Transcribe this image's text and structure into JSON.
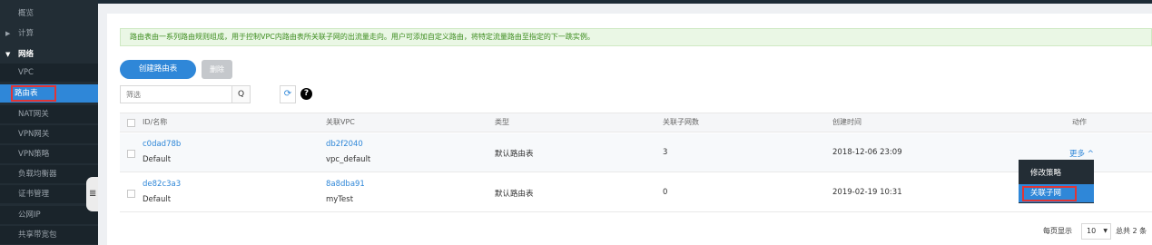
{
  "sidebar": {
    "items": [
      {
        "label": "概览"
      },
      {
        "label": "计算"
      },
      {
        "label": "网络"
      },
      {
        "label": "VPC"
      },
      {
        "label": "路由表"
      },
      {
        "label": "NAT网关"
      },
      {
        "label": "VPN网关"
      },
      {
        "label": "VPN策略"
      },
      {
        "label": "负载均衡器"
      },
      {
        "label": "证书管理"
      },
      {
        "label": "公网IP"
      },
      {
        "label": "共享带宽包"
      }
    ],
    "collapse_icon": "≣"
  },
  "notice": "路由表由一系列路由规则组成，用于控制VPC内路由表所关联子网的出流量走向。用户可添加自定义路由，将特定流量路由至指定的下一跳实例。",
  "toolbar": {
    "create_label": "创建路由表",
    "delete_label": "删除",
    "filter_placeholder": "筛选",
    "search_icon": "Q",
    "refresh_icon": "⟳",
    "help_icon": "?"
  },
  "table": {
    "columns": [
      "ID/名称",
      "关联VPC",
      "类型",
      "关联子网数",
      "创建时间",
      "动作"
    ],
    "rows": [
      {
        "id": "c0dad78b",
        "name": "Default",
        "vpc_id": "db2f2040",
        "vpc_name": "vpc_default",
        "type": "默认路由表",
        "subnets": "3",
        "created": "2018-12-06 23:09",
        "action": "更多 ^"
      },
      {
        "id": "de82c3a3",
        "name": "Default",
        "vpc_id": "8a8dba91",
        "vpc_name": "myTest",
        "type": "默认路由表",
        "subnets": "0",
        "created": "2019-02-19 10:31",
        "action": ""
      }
    ]
  },
  "dropdown": {
    "items": [
      "修改策略",
      "关联子网"
    ]
  },
  "pager": {
    "per_page_label": "每页显示",
    "per_page_value": "10",
    "total_label": "总共 2 条"
  },
  "colors": {
    "sidebar_bg": "#222d35",
    "accent": "#2f87d8",
    "highlight_box": "#e13535",
    "notice_bg": "#eaf7e5"
  }
}
